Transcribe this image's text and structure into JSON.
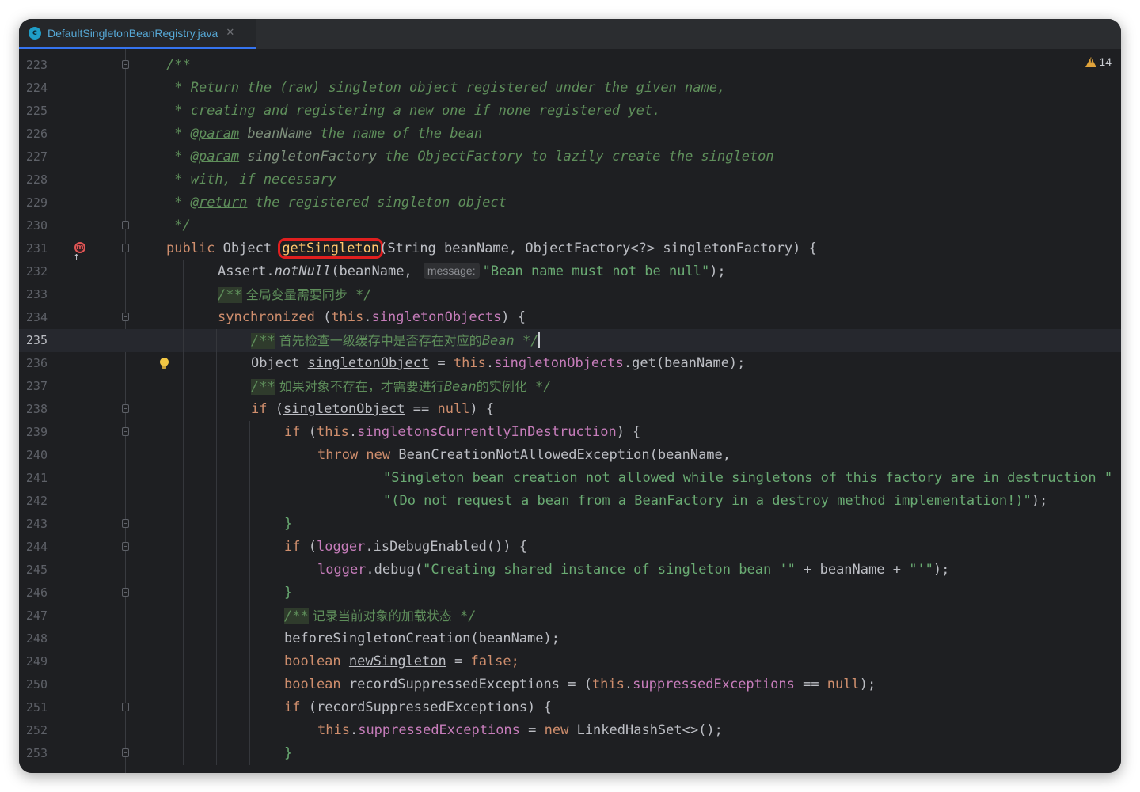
{
  "tab": {
    "icon_letter": "c",
    "title": "DefaultSingletonBeanRegistry.java",
    "close": "✕"
  },
  "warnings": {
    "count": "14"
  },
  "gutter_icon": {
    "letter": "m",
    "arrow": "↑"
  },
  "hint": {
    "message": "message:"
  },
  "lines": [
    {
      "n": "223"
    },
    {
      "n": "224"
    },
    {
      "n": "225"
    },
    {
      "n": "226"
    },
    {
      "n": "227"
    },
    {
      "n": "228"
    },
    {
      "n": "229"
    },
    {
      "n": "230"
    },
    {
      "n": "231"
    },
    {
      "n": "232"
    },
    {
      "n": "233"
    },
    {
      "n": "234"
    },
    {
      "n": "235"
    },
    {
      "n": "236"
    },
    {
      "n": "237"
    },
    {
      "n": "238"
    },
    {
      "n": "239"
    },
    {
      "n": "240"
    },
    {
      "n": "241"
    },
    {
      "n": "242"
    },
    {
      "n": "243"
    },
    {
      "n": "244"
    },
    {
      "n": "245"
    },
    {
      "n": "246"
    },
    {
      "n": "247"
    },
    {
      "n": "248"
    },
    {
      "n": "249"
    },
    {
      "n": "250"
    },
    {
      "n": "251"
    },
    {
      "n": "252"
    },
    {
      "n": "253"
    }
  ],
  "code": {
    "l223": "/**",
    "l224": " * Return the (raw) singleton object registered under the given name,",
    "l225": " * creating and registering a new one if none registered yet.",
    "l226_star": " * ",
    "l226_tag": "@param",
    "l226_param": " beanName",
    "l226_rest": " the name of the bean",
    "l227_star": " * ",
    "l227_tag": "@param",
    "l227_param": " singletonFactory",
    "l227_rest": " the ObjectFactory to lazily create the singleton",
    "l228": " * with, if necessary",
    "l229_star": " * ",
    "l229_tag": "@return",
    "l229_rest": " the registered singleton object",
    "l230": " */",
    "l231_kw": "public",
    "l231_type": " Object ",
    "l231_method": "getSingleton",
    "l231_rest": "(String beanName, ObjectFactory<?> singletonFactory) {",
    "l232_a": "Assert.",
    "l232_m": "notNull",
    "l232_b": "(beanName, ",
    "l232_str": "\"Bean name must not be null\"",
    "l232_end": ");",
    "l233_open": "/**",
    "l233_text": " 全局变量需要同步",
    "l233_close": " */",
    "l234_kw": "synchronized",
    "l234_a": " (",
    "l234_this": "this",
    "l234_dot": ".",
    "l234_fld": "singletonObjects",
    "l234_end": ") {",
    "l235_open": "/**",
    "l235_text": " 首先检查一级缓存中是否存在对应的",
    "l235_bean": "Bean",
    "l235_close": " */",
    "l236_a": "Object ",
    "l236_var": "singletonObject",
    "l236_b": " = ",
    "l236_this": "this",
    "l236_dot": ".",
    "l236_fld": "singletonObjects",
    "l236_c": ".get(beanName);",
    "l237_open": "/**",
    "l237_text1": " 如果对象不存在，才需要进行",
    "l237_bean": "Bean",
    "l237_text2": "的实例化",
    "l237_close": " */",
    "l238_kw": "if",
    "l238_a": " (",
    "l238_var": "singletonObject",
    "l238_b": " == ",
    "l238_null": "null",
    "l238_c": ") {",
    "l239_kw": "if",
    "l239_a": " (",
    "l239_this": "this",
    "l239_dot": ".",
    "l239_fld": "singletonsCurrentlyInDestruction",
    "l239_c": ") {",
    "l240_kw1": "throw",
    "l240_kw2": " new",
    "l240_rest": " BeanCreationNotAllowedException(beanName,",
    "l241_str": "\"Singleton bean creation not allowed while singletons of this factory are in destruction \"",
    "l241_plus": " +",
    "l242_str": "\"(Do not request a bean from a BeanFactory in a destroy method implementation!)\"",
    "l242_end": ");",
    "l243": "}",
    "l244_kw": "if",
    "l244_a": " (",
    "l244_fld": "logger",
    "l244_b": ".isDebugEnabled()) {",
    "l245_fld": "logger",
    "l245_a": ".debug(",
    "l245_str1": "\"Creating shared instance of singleton bean '\"",
    "l245_b": " + beanName + ",
    "l245_str2": "\"'\"",
    "l245_end": ");",
    "l246": "}",
    "l247_open": "/**",
    "l247_text": " 记录当前对象的加载状态",
    "l247_close": " */",
    "l248": "beforeSingletonCreation(beanName);",
    "l249_kw": "boolean",
    "l249_sp": " ",
    "l249_var": "newSingleton",
    "l249_b": " = ",
    "l249_false": "false",
    "l249_end": ";",
    "l250_kw": "boolean",
    "l250_a": " recordSuppressedExceptions = (",
    "l250_this": "this",
    "l250_dot": ".",
    "l250_fld": "suppressedExceptions",
    "l250_b": " == ",
    "l250_null": "null",
    "l250_end": ");",
    "l251_kw": "if",
    "l251_rest": " (recordSuppressedExceptions) {",
    "l252_this": "this",
    "l252_dot": ".",
    "l252_fld": "suppressedExceptions",
    "l252_a": " = ",
    "l252_new": "new",
    "l252_rest": " LinkedHashSet<>();",
    "l253": "}"
  }
}
